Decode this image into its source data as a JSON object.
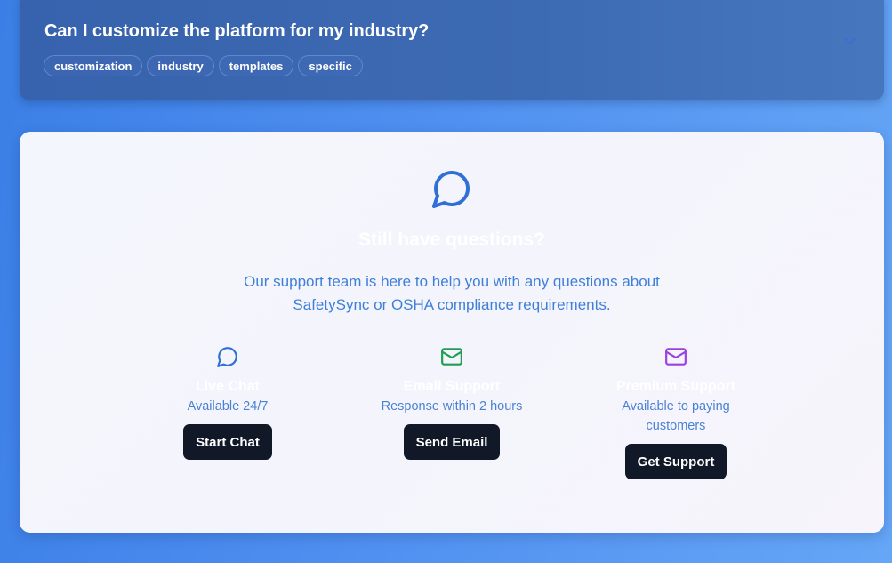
{
  "faq": {
    "question": "Can I customize the platform for my industry?",
    "tags": [
      "customization",
      "industry",
      "templates",
      "specific"
    ],
    "toggle_icon": "chevron-down-icon"
  },
  "support": {
    "icon": "message-circle-icon",
    "title": "Still have questions?",
    "description": "Our support team is here to help you with any questions about SafetySync or OSHA compliance requirements.",
    "options": [
      {
        "icon": "message-circle-icon",
        "icon_color": "#2f6fd6",
        "title": "Live Chat",
        "description": "Available 24/7",
        "button": "Start Chat"
      },
      {
        "icon": "mail-icon",
        "icon_color": "#1f9d55",
        "title": "Email Support",
        "description": "Response within 2 hours",
        "button": "Send Email"
      },
      {
        "icon": "mail-icon",
        "icon_color": "#9b3fe0",
        "title": "Premium Support",
        "description": "Available to paying customers",
        "button": "Get Support"
      }
    ]
  },
  "colors": {
    "background": "#4f8ff0",
    "faq_card": "#3b67b0",
    "button": "#111827",
    "accent_text": "#3f7fd8"
  }
}
